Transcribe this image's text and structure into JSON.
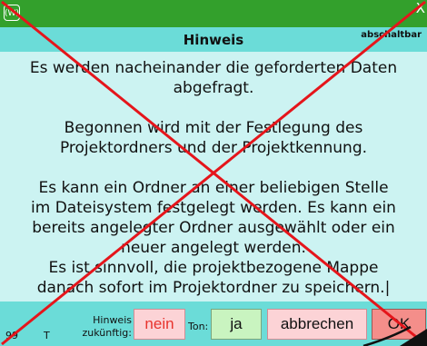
{
  "title_bar": {
    "app_icon": "(W)",
    "close": "X",
    "color": "#33a02c"
  },
  "header": {
    "title": "Hinweis",
    "right_label": "abschaltbar"
  },
  "message": [
    "Es werden nacheinander die geforderten Daten",
    "abgefragt.",
    "",
    "Begonnen wird mit der Festlegung des",
    "Projektordners und der Projektkennung.",
    "",
    "Es kann ein Ordner an einer beliebigen Stelle",
    "im Dateisystem festgelegt werden. Es kann ein",
    "bereits angelegter Ordner ausgewählt oder ein",
    "neuer angelegt werden.",
    "Es ist sinnvoll, die projektbezogene Mappe",
    "danach sofort im Projektordner zu speichern.|"
  ],
  "bottom": {
    "status_number": "99",
    "status_letter": "T",
    "hinweis_label_line1": "Hinweis",
    "hinweis_label_line2": "zukünftig:",
    "nein_label": "nein",
    "ton_label": "Ton:",
    "ja_label": "ja",
    "abbrechen_label": "abbrechen",
    "ok_label": "OK"
  },
  "colors": {
    "background": "#6bdcd8",
    "content": "#ccf3f2",
    "cross_out": "#e5151b"
  }
}
